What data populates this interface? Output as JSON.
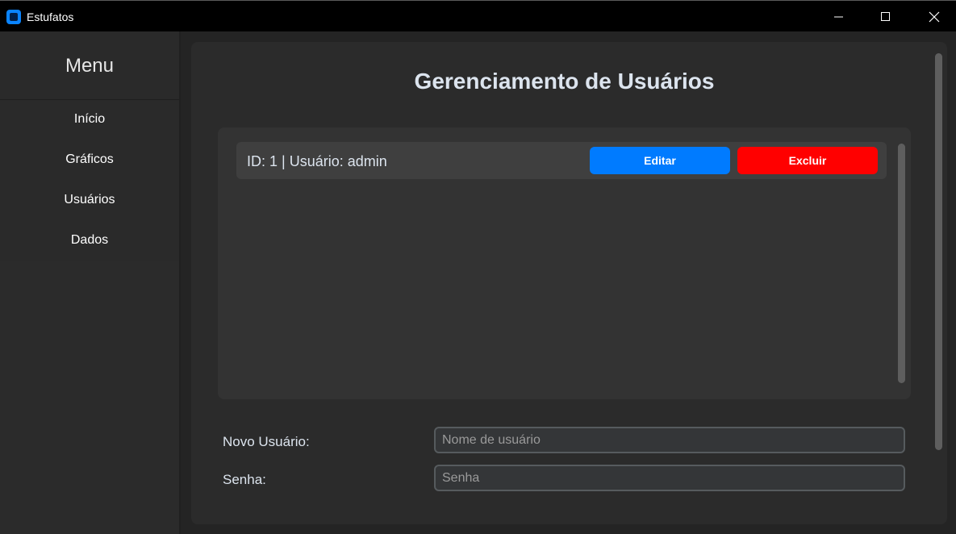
{
  "window": {
    "title": "Estufatos",
    "icon": "app-icon",
    "controls": [
      "minimize-icon",
      "maximize-icon",
      "close-icon"
    ]
  },
  "sidebar": {
    "title": "Menu",
    "items": [
      {
        "label": "Início"
      },
      {
        "label": "Gráficos"
      },
      {
        "label": "Usuários"
      },
      {
        "label": "Dados"
      }
    ]
  },
  "main": {
    "title": "Gerenciamento de Usuários",
    "users": [
      {
        "text": "ID: 1 | Usuário: admin",
        "edit_label": "Editar",
        "delete_label": "Excluir"
      }
    ],
    "form": {
      "new_user_label": "Novo Usuário:",
      "username_placeholder": "Nome de usuário",
      "password_label": "Senha:",
      "password_placeholder": "Senha"
    }
  },
  "colors": {
    "edit_button": "#007bff",
    "delete_button": "#ff0000",
    "background": "#242424",
    "panel": "#2b2b2b"
  }
}
